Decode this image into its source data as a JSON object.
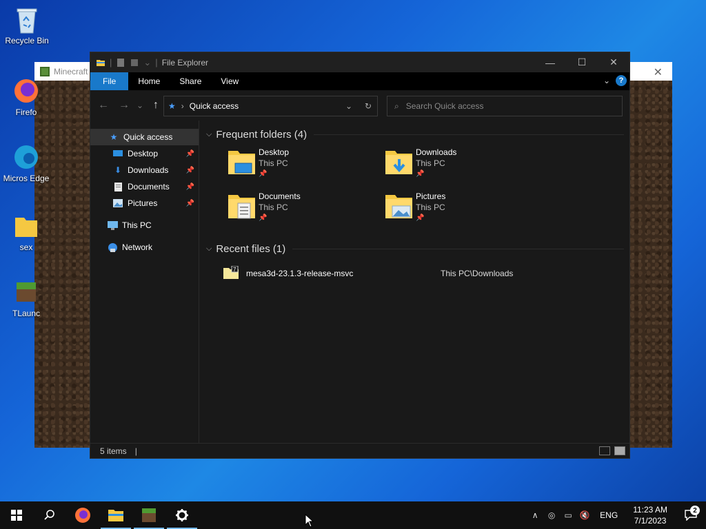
{
  "desktop": {
    "icons": [
      {
        "label": "Recycle Bin"
      },
      {
        "label": "Firefo"
      },
      {
        "label": "Micros Edge"
      },
      {
        "label": "sex"
      },
      {
        "label": "TLaunc"
      }
    ]
  },
  "minecraft_window": {
    "title": "Minecraft",
    "close": "✕"
  },
  "explorer": {
    "title": "File Explorer",
    "window_buttons": {
      "minimize": "—",
      "maximize": "☐",
      "close": "✕"
    },
    "ribbon": {
      "tabs": [
        "File",
        "Home",
        "Share",
        "View"
      ],
      "help": "?"
    },
    "nav": {
      "back": "←",
      "forward": "→",
      "recent": "⌄",
      "up": "↑",
      "address": "Quick access",
      "address_sep": "›",
      "search_placeholder": "Search Quick access"
    },
    "sidebar": {
      "items": [
        {
          "label": "Quick access",
          "pinned": false
        },
        {
          "label": "Desktop",
          "pinned": true
        },
        {
          "label": "Downloads",
          "pinned": true
        },
        {
          "label": "Documents",
          "pinned": true
        },
        {
          "label": "Pictures",
          "pinned": true
        },
        {
          "label": "This PC",
          "pinned": false
        },
        {
          "label": "Network",
          "pinned": false
        }
      ]
    },
    "frequent": {
      "header": "Frequent folders (4)",
      "folders": [
        {
          "name": "Desktop",
          "location": "This PC"
        },
        {
          "name": "Downloads",
          "location": "This PC"
        },
        {
          "name": "Documents",
          "location": "This PC"
        },
        {
          "name": "Pictures",
          "location": "This PC"
        }
      ]
    },
    "recent": {
      "header": "Recent files (1)",
      "files": [
        {
          "name": "mesa3d-23.1.3-release-msvc",
          "path": "This PC\\Downloads"
        }
      ]
    },
    "status": {
      "items": "5 items",
      "cursor": "|"
    }
  },
  "taskbar": {
    "tray": {
      "lang": "ENG",
      "time": "11:23 AM",
      "date": "7/1/2023",
      "notifications": "2",
      "overflow": "∧"
    }
  },
  "colors": {
    "accent": "#1979ca",
    "folder": "#f5c842"
  }
}
